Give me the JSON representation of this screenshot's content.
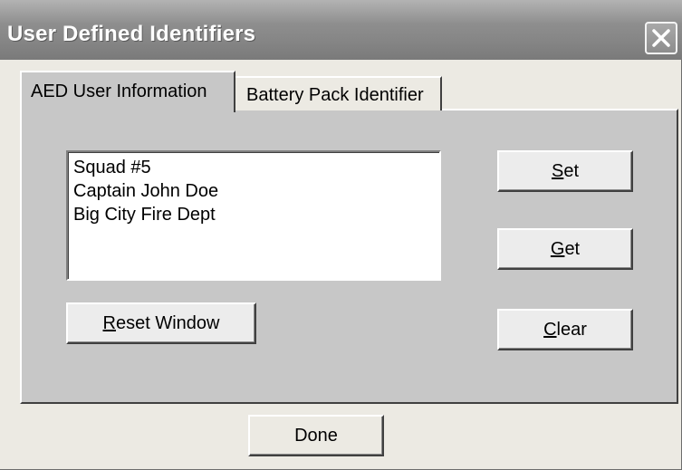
{
  "window": {
    "title": "User Defined Identifiers"
  },
  "tabs": [
    {
      "label": "AED User Information",
      "active": true
    },
    {
      "label": "Battery Pack Identifier",
      "active": false
    }
  ],
  "identifiers_list": {
    "lines": [
      "Squad #5",
      "Captain John Doe",
      "Big City Fire Dept"
    ]
  },
  "buttons": {
    "set": {
      "accel": "S",
      "rest": "et"
    },
    "get": {
      "accel": "G",
      "rest": "et"
    },
    "clear": {
      "accel": "C",
      "rest": "lear"
    },
    "reset_window": {
      "accel": "R",
      "rest": "eset Window"
    },
    "done": "Done"
  },
  "icons": {
    "close": "close-icon"
  },
  "colors": {
    "titlebar": "#858585",
    "title_text": "#ffffff",
    "panel": "#c7c7c7",
    "dialog": "#eceae3"
  }
}
